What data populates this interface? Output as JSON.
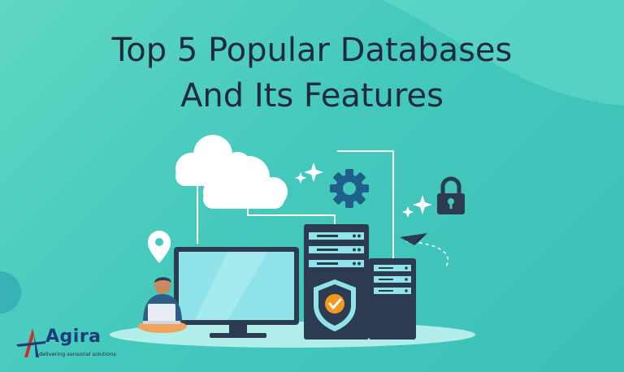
{
  "headline": {
    "line1": "Top 5 Popular Databases",
    "line2": "And Its Features"
  },
  "brand": {
    "name": "Agira",
    "tagline": "delivering sensorial solutions"
  },
  "colors": {
    "background": "#45c9bd",
    "dark": "#2d3b50",
    "screen": "#8fe3e9",
    "accent_orange": "#f39a1e",
    "cloud": "#ffffff"
  },
  "icons": [
    "cloud-icon",
    "gear-icon",
    "lock-icon",
    "location-pin-icon",
    "paper-plane-icon",
    "shield-check-icon",
    "sparkle-icon"
  ]
}
